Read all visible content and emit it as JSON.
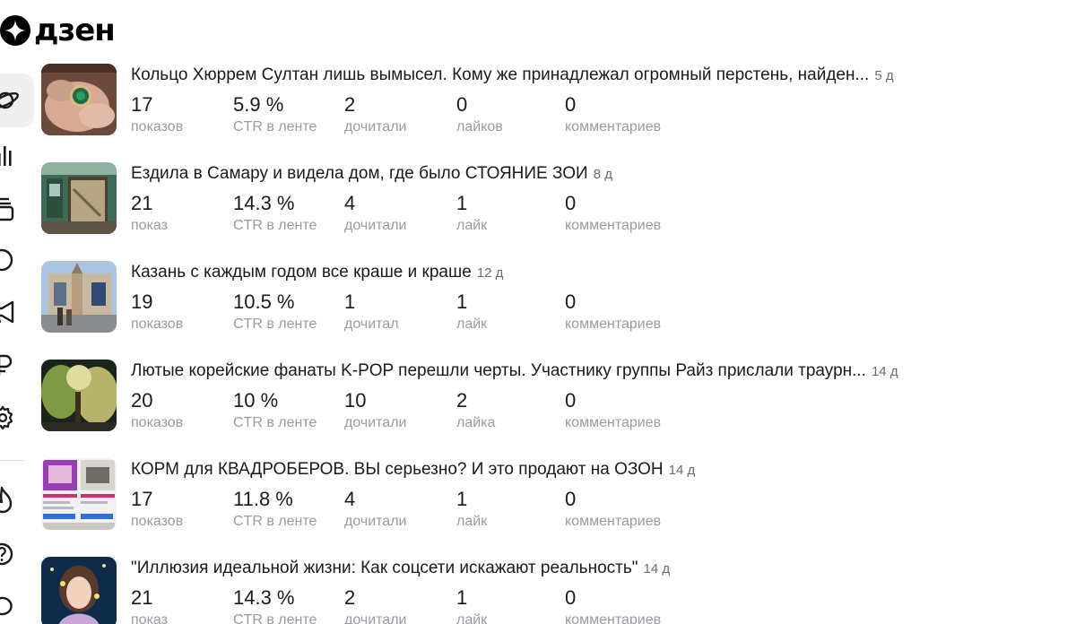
{
  "brand": {
    "name": "дзен"
  },
  "sidebar": {
    "icons": [
      "planet-icon",
      "stats-bars-icon",
      "layers-icon",
      "chat-bubble-icon",
      "megaphone-icon",
      "ruble-icon",
      "gear-icon",
      "fire-icon",
      "help-icon",
      "support-chat-icon"
    ]
  },
  "articles": [
    {
      "title": "Кольцо Хюррем Султан лишь вымысел. Кому же принадлежал огромный перстень, найден...",
      "age": "5 д",
      "stats": [
        {
          "value": "17",
          "label": "показов"
        },
        {
          "value": "5.9 %",
          "label": "CTR в ленте"
        },
        {
          "value": "2",
          "label": "дочитали"
        },
        {
          "value": "0",
          "label": "лайков"
        },
        {
          "value": "0",
          "label": "комментариев"
        }
      ]
    },
    {
      "title": "Ездила в Самару и видела дом, где было СТОЯНИЕ ЗОИ",
      "age": "8 д",
      "stats": [
        {
          "value": "21",
          "label": "показ"
        },
        {
          "value": "14.3 %",
          "label": "CTR в ленте"
        },
        {
          "value": "4",
          "label": "дочитали"
        },
        {
          "value": "1",
          "label": "лайк"
        },
        {
          "value": "0",
          "label": "комментариев"
        }
      ]
    },
    {
      "title": "Казань с каждым годом все краше и краше",
      "age": "12 д",
      "stats": [
        {
          "value": "19",
          "label": "показов"
        },
        {
          "value": "10.5 %",
          "label": "CTR в ленте"
        },
        {
          "value": "1",
          "label": "дочитал"
        },
        {
          "value": "1",
          "label": "лайк"
        },
        {
          "value": "0",
          "label": "комментариев"
        }
      ]
    },
    {
      "title": "Лютые корейские фанаты K-POP перешли черты. Участнику группы Райз прислали траурн...",
      "age": "14 д",
      "stats": [
        {
          "value": "20",
          "label": "показов"
        },
        {
          "value": "10 %",
          "label": "CTR в ленте"
        },
        {
          "value": "10",
          "label": "дочитали"
        },
        {
          "value": "2",
          "label": "лайка"
        },
        {
          "value": "0",
          "label": "комментариев"
        }
      ]
    },
    {
      "title": "КОРМ для КВАДРОБЕРОВ. ВЫ серьезно? И это продают на ОЗОН",
      "age": "14 д",
      "stats": [
        {
          "value": "17",
          "label": "показов"
        },
        {
          "value": "11.8 %",
          "label": "CTR в ленте"
        },
        {
          "value": "4",
          "label": "дочитали"
        },
        {
          "value": "1",
          "label": "лайк"
        },
        {
          "value": "0",
          "label": "комментариев"
        }
      ]
    },
    {
      "title": "\"Иллюзия идеальной жизни: Как соцсети искажают реальность\"",
      "age": "14 д",
      "stats": [
        {
          "value": "21",
          "label": "показ"
        },
        {
          "value": "14.3 %",
          "label": "CTR в ленте"
        },
        {
          "value": "2",
          "label": "дочитали"
        },
        {
          "value": "1",
          "label": "лайк"
        },
        {
          "value": "0",
          "label": "комментариев"
        }
      ]
    }
  ]
}
